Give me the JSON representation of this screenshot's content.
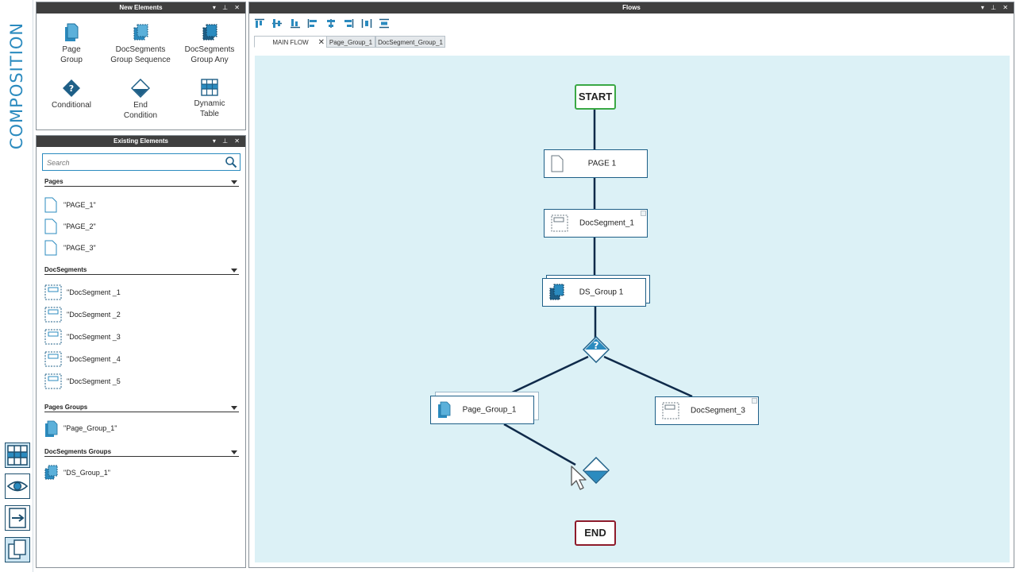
{
  "rail": {
    "title": "COMPOSITION",
    "buttons": [
      "table-view-icon",
      "preview-icon",
      "export-icon",
      "pages-icon"
    ]
  },
  "new_elements": {
    "title": "New Elements",
    "items": [
      {
        "line1": "Page",
        "line2": "Group",
        "icon": "page-group-icon"
      },
      {
        "line1": "DocSegments",
        "line2": "Group Sequence",
        "icon": "docsegments-group-sequence-icon"
      },
      {
        "line1": "DocSegments",
        "line2": "Group Any",
        "icon": "docsegments-group-any-icon"
      },
      {
        "line1": "Conditional",
        "line2": "",
        "icon": "conditional-icon"
      },
      {
        "line1": "End",
        "line2": "Condition",
        "icon": "end-condition-icon"
      },
      {
        "line1": "Dynamic",
        "line2": "Table",
        "icon": "dynamic-table-icon"
      }
    ]
  },
  "existing_elements": {
    "title": "Existing Elements",
    "search_placeholder": "Search",
    "sections": {
      "pages": {
        "title": "Pages",
        "items": [
          "\"PAGE_1\"",
          "\"PAGE_2\"",
          "\"PAGE_3\""
        ]
      },
      "docsegments": {
        "title": "DocSegments",
        "items": [
          "\"DocSegment _1",
          "\"DocSegment _2",
          "\"DocSegment _3",
          "\"DocSegment _4",
          "\"DocSegment _5"
        ]
      },
      "pages_groups": {
        "title": "Pages Groups",
        "items": [
          "\"Page_Group_1\""
        ]
      },
      "docsegments_groups": {
        "title": "DocSegments Groups",
        "items": [
          "\"DS_Group_1\""
        ]
      }
    }
  },
  "flows": {
    "title": "Flows",
    "tabs": [
      {
        "label": "MAIN FLOW",
        "active": true,
        "close": "✕"
      },
      {
        "label": "Page_Group_1",
        "active": false
      },
      {
        "label": "DocSegment_Group_1",
        "active": false
      }
    ],
    "nodes": {
      "start": "START",
      "page1": "PAGE 1",
      "docsegment1": "DocSegment_1",
      "dsgroup1": "DS_Group 1",
      "conditional": "?",
      "pagegroup1": "Page_Group_1",
      "docsegment3": "DocSegment_3",
      "end": "END"
    }
  },
  "colors": {
    "accent": "#2b8bbf",
    "dark_blue": "#1e5f87",
    "canvas": "#dcf1f6",
    "panel_header": "#3f3f3f",
    "start_border": "#3aa845",
    "end_border": "#8e1b2b",
    "connector": "#0f2a4a"
  }
}
